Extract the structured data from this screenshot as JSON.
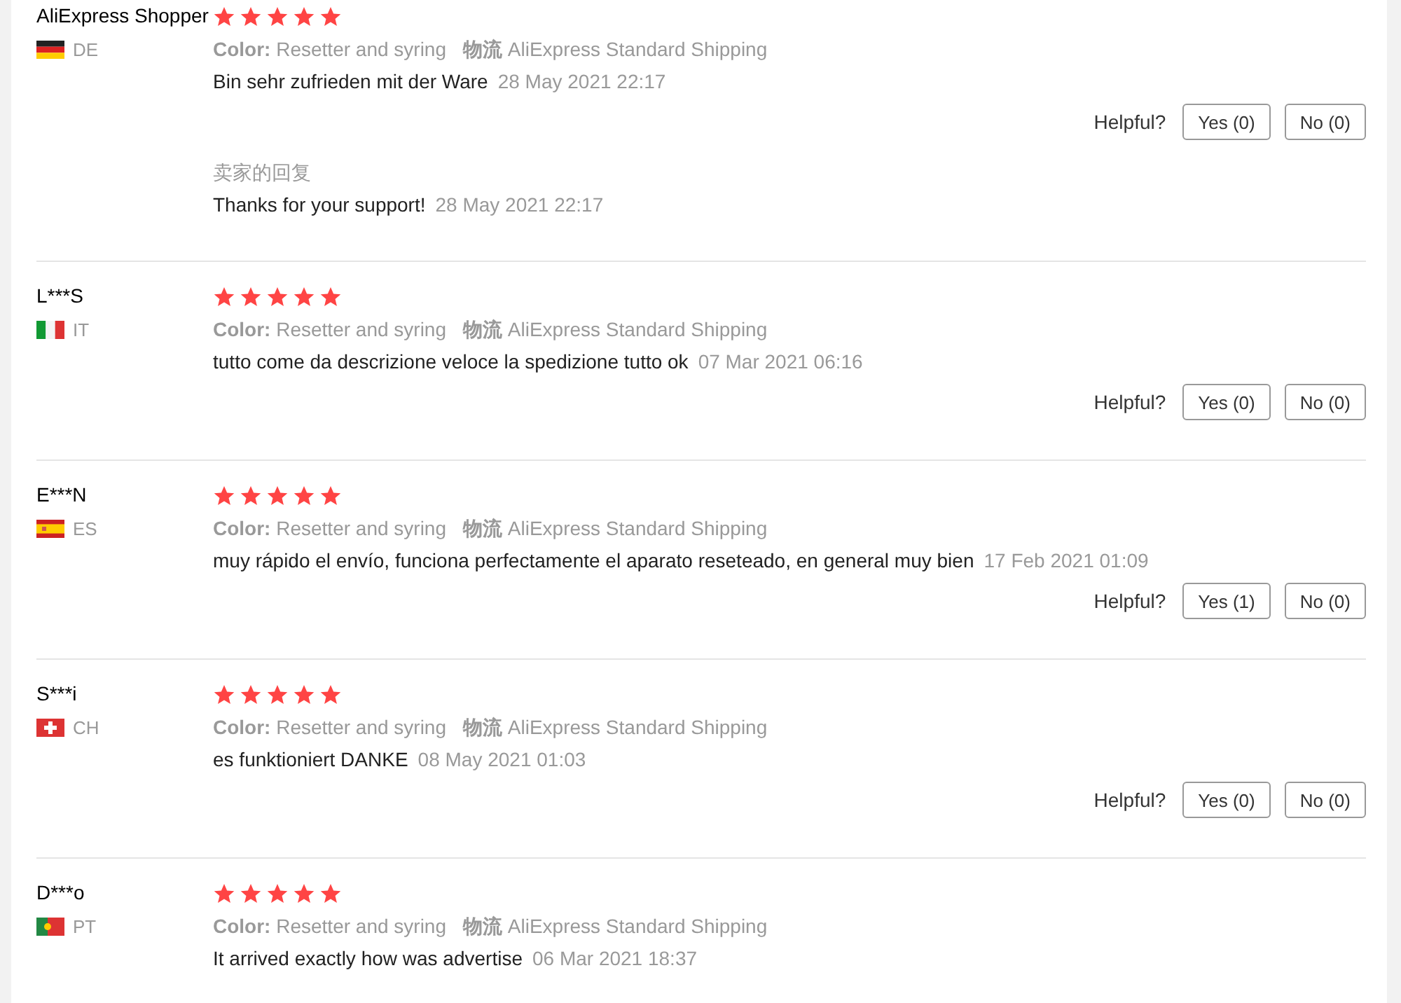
{
  "reviews": [
    {
      "name": "AliExpress Shopper",
      "kind": "de",
      "country": "DE",
      "stars": 5,
      "color_label": "Color:",
      "color_value": "Resetter and syring",
      "shipping_label": "物流",
      "shipping_value": "AliExpress Standard Shipping",
      "comment": "Bin sehr zufrieden mit der Ware",
      "date": "28 May 2021 22:17",
      "helpful": "Helpful?",
      "yes": "Yes (0)",
      "no": "No (0)",
      "reply": {
        "label": "卖家的回复",
        "text": "Thanks for your support!",
        "date": "28 May 2021 22:17"
      }
    },
    {
      "name": "L***S",
      "kind": "it",
      "country": "IT",
      "stars": 5,
      "color_label": "Color:",
      "color_value": "Resetter and syring",
      "shipping_label": "物流",
      "shipping_value": "AliExpress Standard Shipping",
      "comment": "tutto come da descrizione veloce la spedizione tutto ok",
      "date": "07 Mar 2021 06:16",
      "helpful": "Helpful?",
      "yes": "Yes (0)",
      "no": "No (0)"
    },
    {
      "name": "E***N",
      "kind": "es",
      "country": "ES",
      "stars": 5,
      "color_label": "Color:",
      "color_value": "Resetter and syring",
      "shipping_label": "物流",
      "shipping_value": "AliExpress Standard Shipping",
      "comment": "muy rápido el envío, funciona perfectamente el aparato reseteado, en general muy bien",
      "date": "17 Feb 2021 01:09",
      "helpful": "Helpful?",
      "yes": "Yes (1)",
      "no": "No (0)"
    },
    {
      "name": "S***i",
      "kind": "ch",
      "country": "CH",
      "stars": 5,
      "color_label": "Color:",
      "color_value": "Resetter and syring",
      "shipping_label": "物流",
      "shipping_value": "AliExpress Standard Shipping",
      "comment": "es funktioniert DANKE",
      "date": "08 May 2021 01:03",
      "helpful": "Helpful?",
      "yes": "Yes (0)",
      "no": "No (0)"
    },
    {
      "name": "D***o",
      "kind": "pt",
      "country": "PT",
      "stars": 5,
      "color_label": "Color:",
      "color_value": "Resetter and syring",
      "shipping_label": "物流",
      "shipping_value": "AliExpress Standard Shipping",
      "comment": "It arrived exactly how was advertise",
      "date": "06 Mar 2021 18:37"
    }
  ]
}
